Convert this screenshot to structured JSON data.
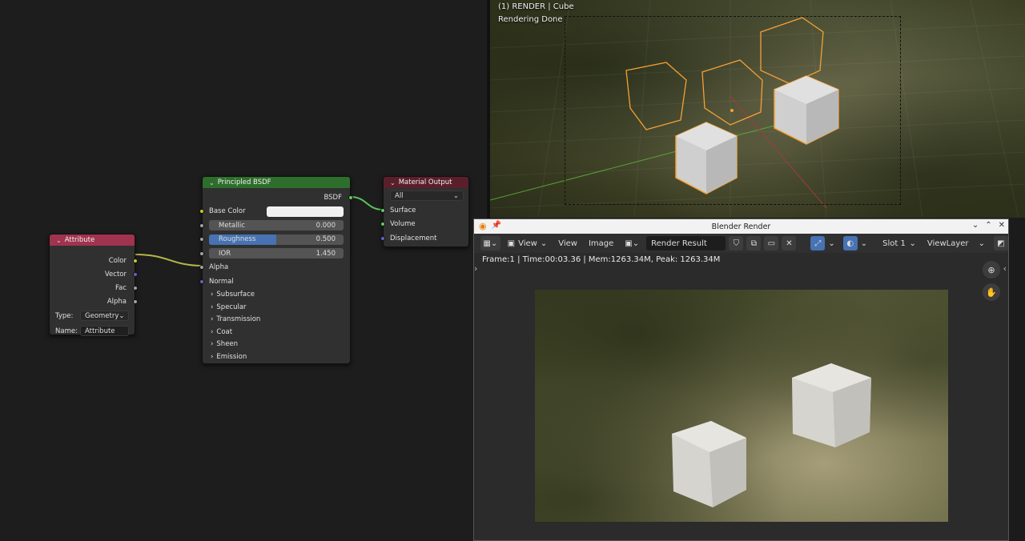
{
  "colors": {
    "attribute_header": "#a0334f",
    "bsdf_header": "#2e6e2c",
    "output_header": "#5a1f2b",
    "socket_color": "#c7c729",
    "socket_vector": "#6363c7",
    "socket_gray": "#a1a1a1",
    "socket_shader": "#63c763",
    "roughness_fill": "#4772b3",
    "selection_orange": "#f5a033"
  },
  "node_attribute": {
    "title": "Attribute",
    "outputs": [
      "Color",
      "Vector",
      "Fac",
      "Alpha"
    ],
    "type_label": "Type:",
    "type_value": "Geometry",
    "name_label": "Name:",
    "name_value": "Attribute"
  },
  "node_bsdf": {
    "title": "Principled BSDF",
    "output": "BSDF",
    "base_color_label": "Base Color",
    "metallic_label": "Metallic",
    "metallic_value": "0.000",
    "roughness_label": "Roughness",
    "roughness_value": "0.500",
    "roughness_fraction": 0.5,
    "ior_label": "IOR",
    "ior_value": "1.450",
    "alpha_label": "Alpha",
    "normal_label": "Normal",
    "panels": [
      "Subsurface",
      "Specular",
      "Transmission",
      "Coat",
      "Sheen",
      "Emission"
    ]
  },
  "node_output": {
    "title": "Material Output",
    "target": "All",
    "inputs": [
      "Surface",
      "Volume",
      "Displacement"
    ]
  },
  "viewport": {
    "line1": "(1) RENDER | Cube",
    "line2": "Rendering Done"
  },
  "render_window": {
    "title": "Blender Render",
    "menu_view1": "View",
    "menu_view2": "View",
    "menu_image": "Image",
    "image_name": "Render Result",
    "slot": "Slot 1",
    "view_layer": "ViewLayer",
    "stats": "Frame:1 | Time:00:03.36 | Mem:1263.34M, Peak: 1263.34M"
  }
}
